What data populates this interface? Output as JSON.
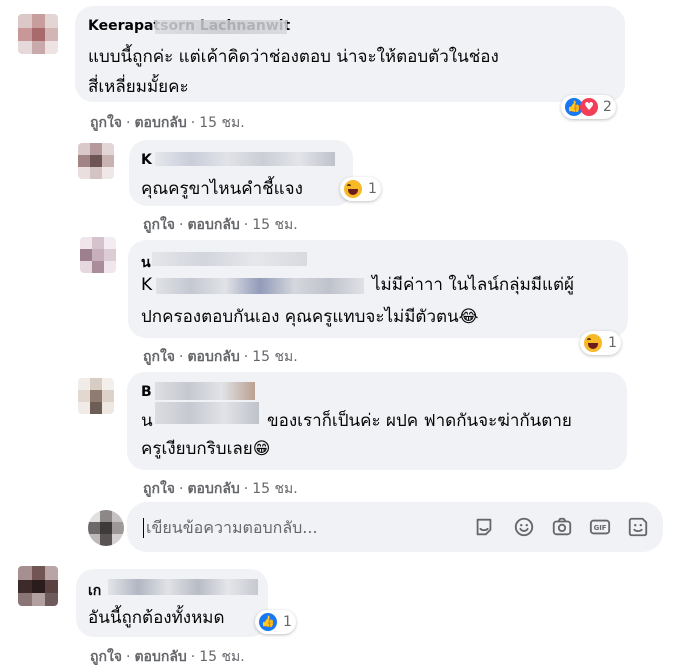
{
  "comments": [
    {
      "name": "Keerapatsorn Lachnanwit",
      "lines": [
        "แบบนี้ถูกค่ะ แต่เค้าคิดว่าช่องตอบ น่าจะให้ตอบตัวในช่อง",
        "สี่เหลี่ยมมั้ยคะ"
      ],
      "reaction_count": "2",
      "reactions": [
        "like-icon",
        "love-icon"
      ]
    },
    {
      "name": "K",
      "lines": [
        "คุณครูขาไหนคำชี้แจง"
      ],
      "reaction_count": "1",
      "reactions": [
        "haha-icon"
      ]
    },
    {
      "name": "น",
      "lines_prefix": "K",
      "lines": [
        "ไม่มีค่าาา ในไลน์กลุ่มมีแต่ผู้",
        "ปกครองตอบกันเอง คุณครูแทบจะไม่มีตัวตน😂"
      ],
      "reaction_count": "1",
      "reactions": [
        "haha-icon"
      ]
    },
    {
      "name": "B",
      "lines_prefix": "น",
      "lines": [
        "ของเราก็เป็นค่ะ ผปค ฟาดกันจะฆ่ากันตาย",
        "ครูเงียบกริบเลย😁"
      ]
    },
    {
      "name": "เก",
      "lines": [
        "อันนี้ถูกต้องทั้งหมด"
      ],
      "reaction_count": "1",
      "reactions": [
        "like-icon"
      ]
    }
  ],
  "actions": {
    "like": "ถูกใจ",
    "reply": "ตอบกลับ",
    "separator": "·",
    "time": "15 ชม."
  },
  "reply_input": {
    "placeholder": "เขียนข้อความตอบกลับ...",
    "tools": [
      "sticker-icon",
      "emoji-icon",
      "camera-icon",
      "gif-icon",
      "sticker-alt-icon"
    ]
  },
  "colors": {
    "bubble": "#f0f2f5",
    "secondary_text": "#65676b",
    "like_blue": "#1877f2",
    "love_red": "#f33e58",
    "haha_yellow": "#f7b928"
  }
}
